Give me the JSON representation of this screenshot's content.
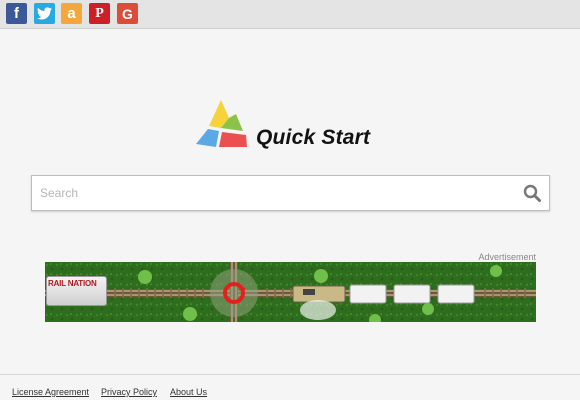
{
  "header": {
    "social": [
      {
        "icon": "facebook-icon",
        "glyph": "f",
        "color": "#3b5998"
      },
      {
        "icon": "twitter-icon",
        "glyph": "",
        "color": "#29a9e1"
      },
      {
        "icon": "amazon-icon",
        "glyph": "a",
        "color": "#f3a73c"
      },
      {
        "icon": "pinterest-icon",
        "glyph": "P",
        "color": "#cb2027"
      },
      {
        "icon": "google-icon",
        "glyph": "G",
        "color": "#dd4b39"
      }
    ]
  },
  "logo": {
    "brand": "Quick Start",
    "colors": {
      "yellow": "#f6d23b",
      "green": "#8bc34a",
      "blue": "#5aa9e6",
      "red": "#ec4f4f"
    }
  },
  "search": {
    "placeholder": "Search",
    "value": ""
  },
  "ad": {
    "label": "Advertisement",
    "game_logo_text": "RAIL NATION"
  },
  "footer": {
    "links": [
      "License Agreement",
      "Privacy Policy",
      "About Us"
    ]
  }
}
